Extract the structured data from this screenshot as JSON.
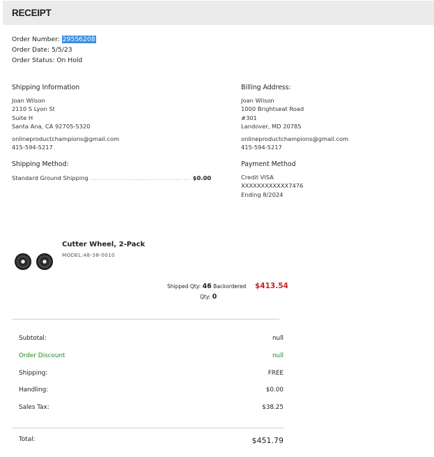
{
  "header": {
    "title": "RECEIPT"
  },
  "order": {
    "number_label": "Order Number:",
    "number": "29556208",
    "date_label": "Order Date:",
    "date": "5/5/23",
    "status_label": "Order Status:",
    "status": "On Hold"
  },
  "shipping": {
    "title": "Shipping Information",
    "lines": [
      "Joan Wilson",
      "2110 S Lyon St",
      "Suite H",
      "Santa Ana, CA 92705-5320"
    ],
    "email": "onlineproductchampions@gmail.com",
    "phone": "415-594-5217",
    "method_title": "Shipping Method:",
    "method_name": "Standard Ground Shipping",
    "method_dots": "...............................................",
    "method_price": "$0.00"
  },
  "billing": {
    "title": "Billing Address:",
    "lines": [
      "Joan Wilson",
      "1000 Brightseat Road",
      "#301",
      "Landover, MD 20785"
    ],
    "email": "onlineproductchampions@gmail.com",
    "phone": "415-594-5217",
    "payment_title": "Payment Method",
    "payment_lines": [
      "Credit VISA",
      "XXXXXXXXXXXX7476",
      "Ending 8/2024"
    ]
  },
  "product": {
    "title": "Cutter Wheel, 2-Pack",
    "model": "MODEL:48-38-0010",
    "shipped_label": "Shipped Qty:",
    "shipped_qty": "46",
    "backordered_label": "Backordered",
    "backordered_qty_label": "Qty:",
    "backordered_qty": "0",
    "price": "$413.54"
  },
  "totals": {
    "subtotal_label": "Subtotal:",
    "subtotal": "null",
    "discount_label": "Order Discount",
    "discount": "null",
    "shipping_label": "Shipping:",
    "shipping": "FREE",
    "handling_label": "Handling:",
    "handling": "$0.00",
    "tax_label": "Sales Tax:",
    "tax": "$38.25",
    "total_label": "Total:",
    "total": "$451.79"
  },
  "colors": {
    "header_bg": "#ebebeb",
    "price_red": "#c62024",
    "discount_green": "#1f8a1f",
    "selection_blue": "#3a8ee6"
  }
}
